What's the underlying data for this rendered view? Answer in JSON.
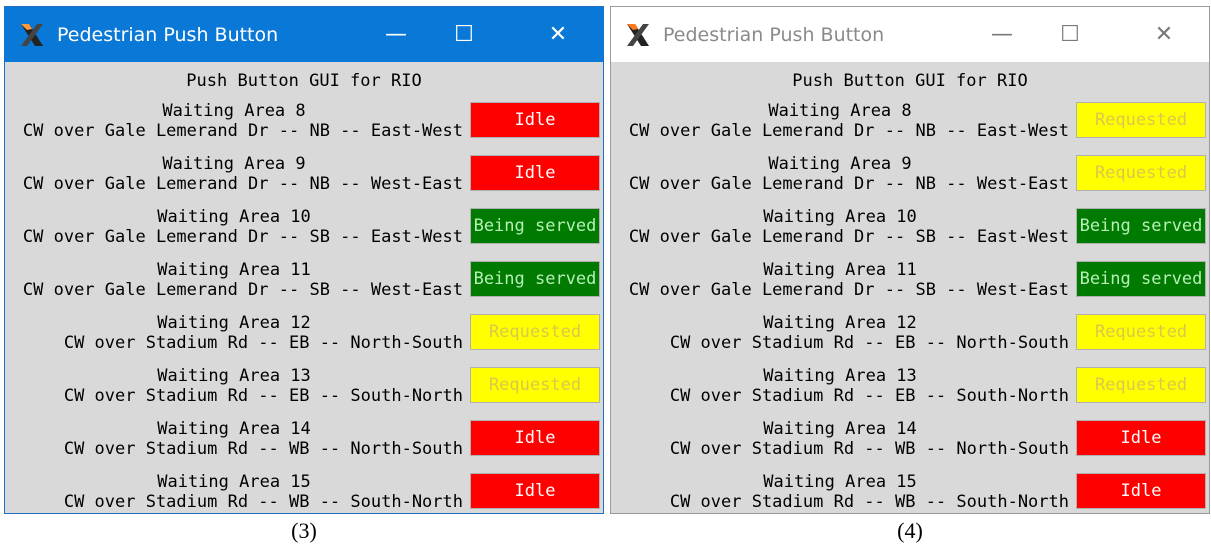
{
  "windows": [
    {
      "state": "active",
      "title": "Pedestrian Push Button",
      "controls": {
        "minimize": "—",
        "maximize": "☐",
        "close": "✕"
      },
      "gui_title": "Push Button GUI for RIO",
      "rows": [
        {
          "area": "Waiting Area 8",
          "desc": "CW over Gale Lemerand Dr -- NB -- East-West",
          "status": "Idle",
          "kind": "idle"
        },
        {
          "area": "Waiting Area 9",
          "desc": "CW over Gale Lemerand Dr -- NB -- West-East",
          "status": "Idle",
          "kind": "idle"
        },
        {
          "area": "Waiting Area 10",
          "desc": "CW over Gale Lemerand Dr -- SB -- East-West",
          "status": "Being served",
          "kind": "served"
        },
        {
          "area": "Waiting Area 11",
          "desc": "CW over Gale Lemerand Dr -- SB -- West-East",
          "status": "Being served",
          "kind": "served"
        },
        {
          "area": "Waiting Area 12",
          "desc": "CW over Stadium Rd -- EB -- North-South",
          "status": "Requested",
          "kind": "requested"
        },
        {
          "area": "Waiting Area 13",
          "desc": "CW over Stadium Rd -- EB -- South-North",
          "status": "Requested",
          "kind": "requested"
        },
        {
          "area": "Waiting Area 14",
          "desc": "CW over Stadium Rd -- WB -- North-South",
          "status": "Idle",
          "kind": "idle"
        },
        {
          "area": "Waiting Area 15",
          "desc": "CW over Stadium Rd -- WB -- South-North",
          "status": "Idle",
          "kind": "idle"
        }
      ],
      "caption": "(3)"
    },
    {
      "state": "inactive",
      "title": "Pedestrian Push Button",
      "controls": {
        "minimize": "—",
        "maximize": "☐",
        "close": "✕"
      },
      "gui_title": "Push Button GUI for RIO",
      "rows": [
        {
          "area": "Waiting Area 8",
          "desc": "CW over Gale Lemerand Dr -- NB -- East-West",
          "status": "Requested",
          "kind": "requested"
        },
        {
          "area": "Waiting Area 9",
          "desc": "CW over Gale Lemerand Dr -- NB -- West-East",
          "status": "Requested",
          "kind": "requested"
        },
        {
          "area": "Waiting Area 10",
          "desc": "CW over Gale Lemerand Dr -- SB -- East-West",
          "status": "Being served",
          "kind": "served"
        },
        {
          "area": "Waiting Area 11",
          "desc": "CW over Gale Lemerand Dr -- SB -- West-East",
          "status": "Being served",
          "kind": "served"
        },
        {
          "area": "Waiting Area 12",
          "desc": "CW over Stadium Rd -- EB -- North-South",
          "status": "Requested",
          "kind": "requested"
        },
        {
          "area": "Waiting Area 13",
          "desc": "CW over Stadium Rd -- EB -- South-North",
          "status": "Requested",
          "kind": "requested"
        },
        {
          "area": "Waiting Area 14",
          "desc": "CW over Stadium Rd -- WB -- North-South",
          "status": "Idle",
          "kind": "idle"
        },
        {
          "area": "Waiting Area 15",
          "desc": "CW over Stadium Rd -- WB -- South-North",
          "status": "Idle",
          "kind": "idle"
        }
      ],
      "caption": "(4)"
    }
  ],
  "colors": {
    "idle": "#ff0000",
    "being_served": "#007a00",
    "requested": "#ffff00",
    "active_titlebar": "#0a78d7",
    "window_bg": "#d9d9d9"
  },
  "icons": {
    "app": "x-window-icon",
    "minimize": "minimize-icon",
    "maximize": "maximize-icon",
    "close": "close-icon"
  }
}
